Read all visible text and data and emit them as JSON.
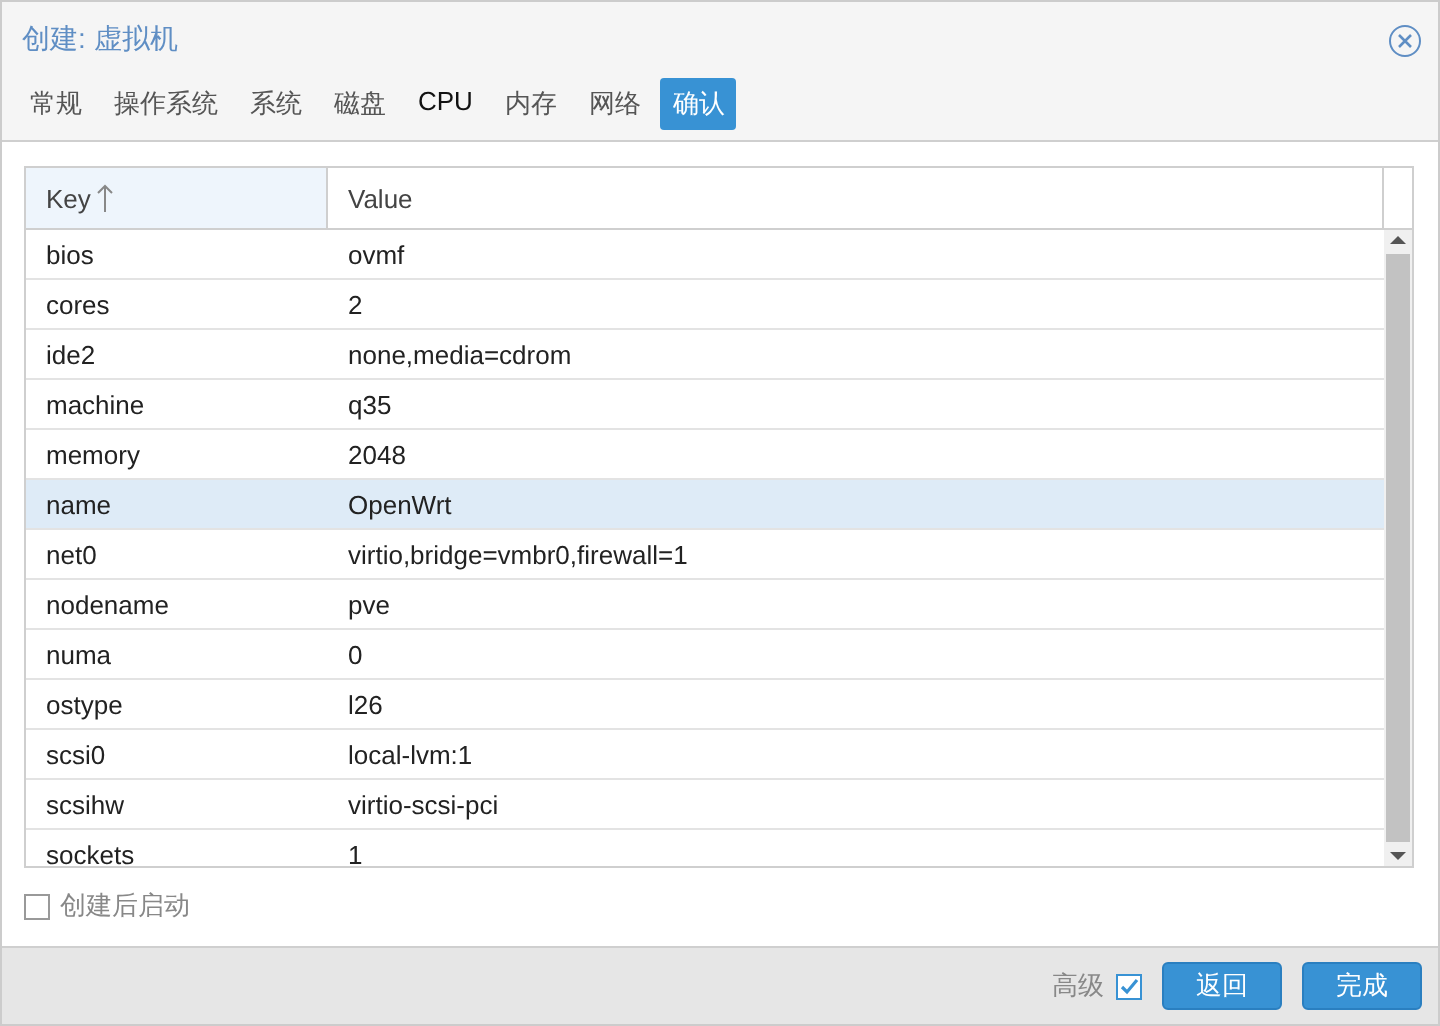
{
  "window": {
    "title": "创建: 虚拟机"
  },
  "tabs": [
    {
      "label": "常规",
      "selected": false,
      "hovered": false
    },
    {
      "label": "操作系统",
      "selected": false,
      "hovered": false
    },
    {
      "label": "系统",
      "selected": false,
      "hovered": false
    },
    {
      "label": "磁盘",
      "selected": false,
      "hovered": false
    },
    {
      "label": "CPU",
      "selected": false,
      "hovered": true
    },
    {
      "label": "内存",
      "selected": false,
      "hovered": false
    },
    {
      "label": "网络",
      "selected": false,
      "hovered": false
    },
    {
      "label": "确认",
      "selected": true,
      "hovered": false
    }
  ],
  "table": {
    "columns": [
      {
        "label": "Key",
        "sorted": true
      },
      {
        "label": "Value",
        "sorted": false
      }
    ],
    "rows": [
      {
        "key": "bios",
        "value": "ovmf",
        "selected": false
      },
      {
        "key": "cores",
        "value": "2",
        "selected": false
      },
      {
        "key": "ide2",
        "value": "none,media=cdrom",
        "selected": false
      },
      {
        "key": "machine",
        "value": "q35",
        "selected": false
      },
      {
        "key": "memory",
        "value": "2048",
        "selected": false
      },
      {
        "key": "name",
        "value": "OpenWrt",
        "selected": true
      },
      {
        "key": "net0",
        "value": "virtio,bridge=vmbr0,firewall=1",
        "selected": false
      },
      {
        "key": "nodename",
        "value": "pve",
        "selected": false
      },
      {
        "key": "numa",
        "value": "0",
        "selected": false
      },
      {
        "key": "ostype",
        "value": "l26",
        "selected": false
      },
      {
        "key": "scsi0",
        "value": "local-lvm:1",
        "selected": false
      },
      {
        "key": "scsihw",
        "value": "virtio-scsi-pci",
        "selected": false
      },
      {
        "key": "sockets",
        "value": "1",
        "selected": false
      }
    ]
  },
  "start_after_create": {
    "label": "创建后启动",
    "checked": false
  },
  "footer": {
    "advanced": {
      "label": "高级",
      "checked": true
    },
    "buttons": [
      "返回",
      "完成"
    ]
  }
}
